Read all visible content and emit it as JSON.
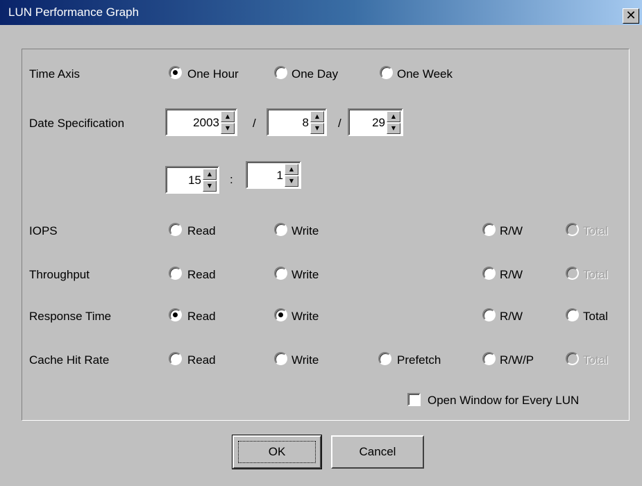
{
  "window": {
    "title": "LUN Performance Graph",
    "close_glyph": "✕"
  },
  "time_axis": {
    "label": "Time Axis",
    "options": [
      "One Hour",
      "One Day",
      "One Week"
    ],
    "selected": "One Hour"
  },
  "date_spec": {
    "label": "Date Specification",
    "year": "2003",
    "month": "8",
    "day": "29",
    "hour": "15",
    "minute": "1",
    "date_separator": "/",
    "time_separator": ":"
  },
  "metrics": {
    "iops": {
      "label": "IOPS",
      "read": "Read",
      "write": "Write",
      "rw": "R/W",
      "total": "Total",
      "total_enabled": false
    },
    "throughput": {
      "label": "Throughput",
      "read": "Read",
      "write": "Write",
      "rw": "R/W",
      "total": "Total",
      "total_enabled": false
    },
    "response_time": {
      "label": "Response Time",
      "read": "Read",
      "write": "Write",
      "rw": "R/W",
      "total": "Total",
      "read_checked": true,
      "write_checked": true,
      "total_enabled": true
    },
    "cache_hit_rate": {
      "label": "Cache Hit Rate",
      "read": "Read",
      "write": "Write",
      "prefetch": "Prefetch",
      "rwp": "R/W/P",
      "total": "Total",
      "total_enabled": false
    }
  },
  "open_window": {
    "label": "Open Window for Every LUN",
    "checked": false
  },
  "buttons": {
    "ok": "OK",
    "cancel": "Cancel"
  },
  "icons": {
    "spin_up": "▲",
    "spin_down": "▼",
    "radio": "radio-icon",
    "checkbox": "checkbox-icon",
    "close": "close-icon"
  }
}
